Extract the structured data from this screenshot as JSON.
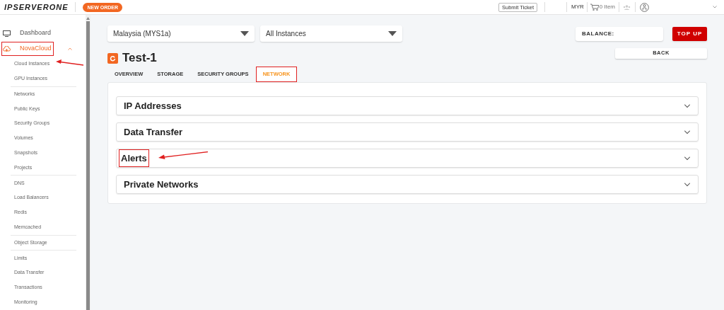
{
  "header": {
    "logo": "IPSERVERONE",
    "new_order": "NEW ORDER",
    "submit_ticket": "Submit Ticket",
    "currency": "MYR",
    "cart": "0 Item"
  },
  "sidebar": {
    "items": [
      {
        "label": "Dashboard",
        "kind": "link",
        "highlighted": false
      },
      {
        "label": "NovaCloud",
        "kind": "section",
        "highlighted": true,
        "expanded": true,
        "groups": [
          {
            "items": [
              {
                "label": "Cloud Instances",
                "pointed": true
              },
              {
                "label": "GPU Instances",
                "pointed": false
              }
            ]
          },
          {
            "items": [
              {
                "label": "Networks",
                "pointed": false
              },
              {
                "label": "Public Keys",
                "pointed": false
              },
              {
                "label": "Security Groups",
                "pointed": false
              },
              {
                "label": "Volumes",
                "pointed": false
              },
              {
                "label": "Snapshots",
                "pointed": false
              },
              {
                "label": "Projects",
                "pointed": false
              }
            ]
          },
          {
            "items": [
              {
                "label": "DNS",
                "pointed": false
              },
              {
                "label": "Load Balancers",
                "pointed": false
              },
              {
                "label": "Redis",
                "pointed": false
              },
              {
                "label": "Memcached",
                "pointed": false
              }
            ]
          },
          {
            "items": [
              {
                "label": "Object Storage",
                "pointed": false
              }
            ]
          },
          {
            "items": [
              {
                "label": "Limits",
                "pointed": false
              },
              {
                "label": "Data Transfer",
                "pointed": false
              },
              {
                "label": "Transactions",
                "pointed": false
              },
              {
                "label": "Monitoring",
                "pointed": false
              }
            ]
          }
        ]
      }
    ]
  },
  "filters": {
    "region": "Malaysia (MYS1a)",
    "instances": "All Instances"
  },
  "balance": {
    "label": "BALANCE:",
    "top_up": "TOP UP"
  },
  "instance": {
    "title": "Test-1",
    "back": "BACK"
  },
  "tabs": [
    {
      "label": "OVERVIEW",
      "selected": false,
      "highlighted": false
    },
    {
      "label": "STORAGE",
      "selected": false,
      "highlighted": false
    },
    {
      "label": "SECURITY GROUPS",
      "selected": false,
      "highlighted": false
    },
    {
      "label": "NETWORK",
      "selected": true,
      "highlighted": true
    }
  ],
  "sections": [
    {
      "title": "IP Addresses",
      "expanded": false,
      "highlighted": false
    },
    {
      "title": "Data Transfer",
      "expanded": false,
      "highlighted": false
    },
    {
      "title": "Alerts",
      "expanded": false,
      "highlighted": true
    },
    {
      "title": "Private Networks",
      "expanded": false,
      "highlighted": false
    }
  ]
}
